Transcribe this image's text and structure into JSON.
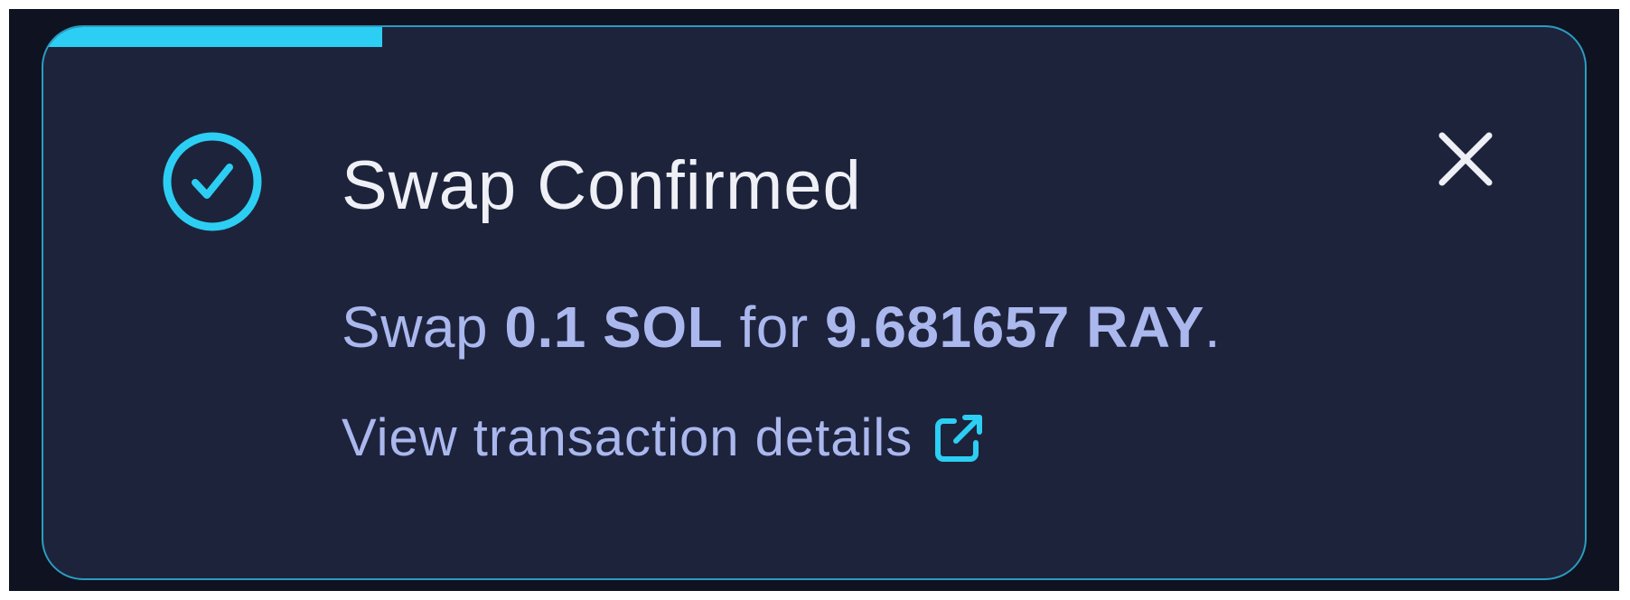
{
  "toast": {
    "title": "Swap Confirmed",
    "progress_fraction": 0.22,
    "message": {
      "prefix": "Swap ",
      "from_amount": "0.1 SOL",
      "connector": " for ",
      "to_amount": "9.681657 RAY",
      "suffix": "."
    },
    "details_link_label": "View transaction details",
    "icons": {
      "status": "check-circle-icon",
      "close": "close-icon",
      "external": "external-link-icon"
    }
  },
  "colors": {
    "accent": "#2ccff3",
    "panel_background": "#1e233c",
    "border": "#2a9dc1",
    "title_text": "#eef0f6",
    "body_text": "#aab8ee"
  }
}
